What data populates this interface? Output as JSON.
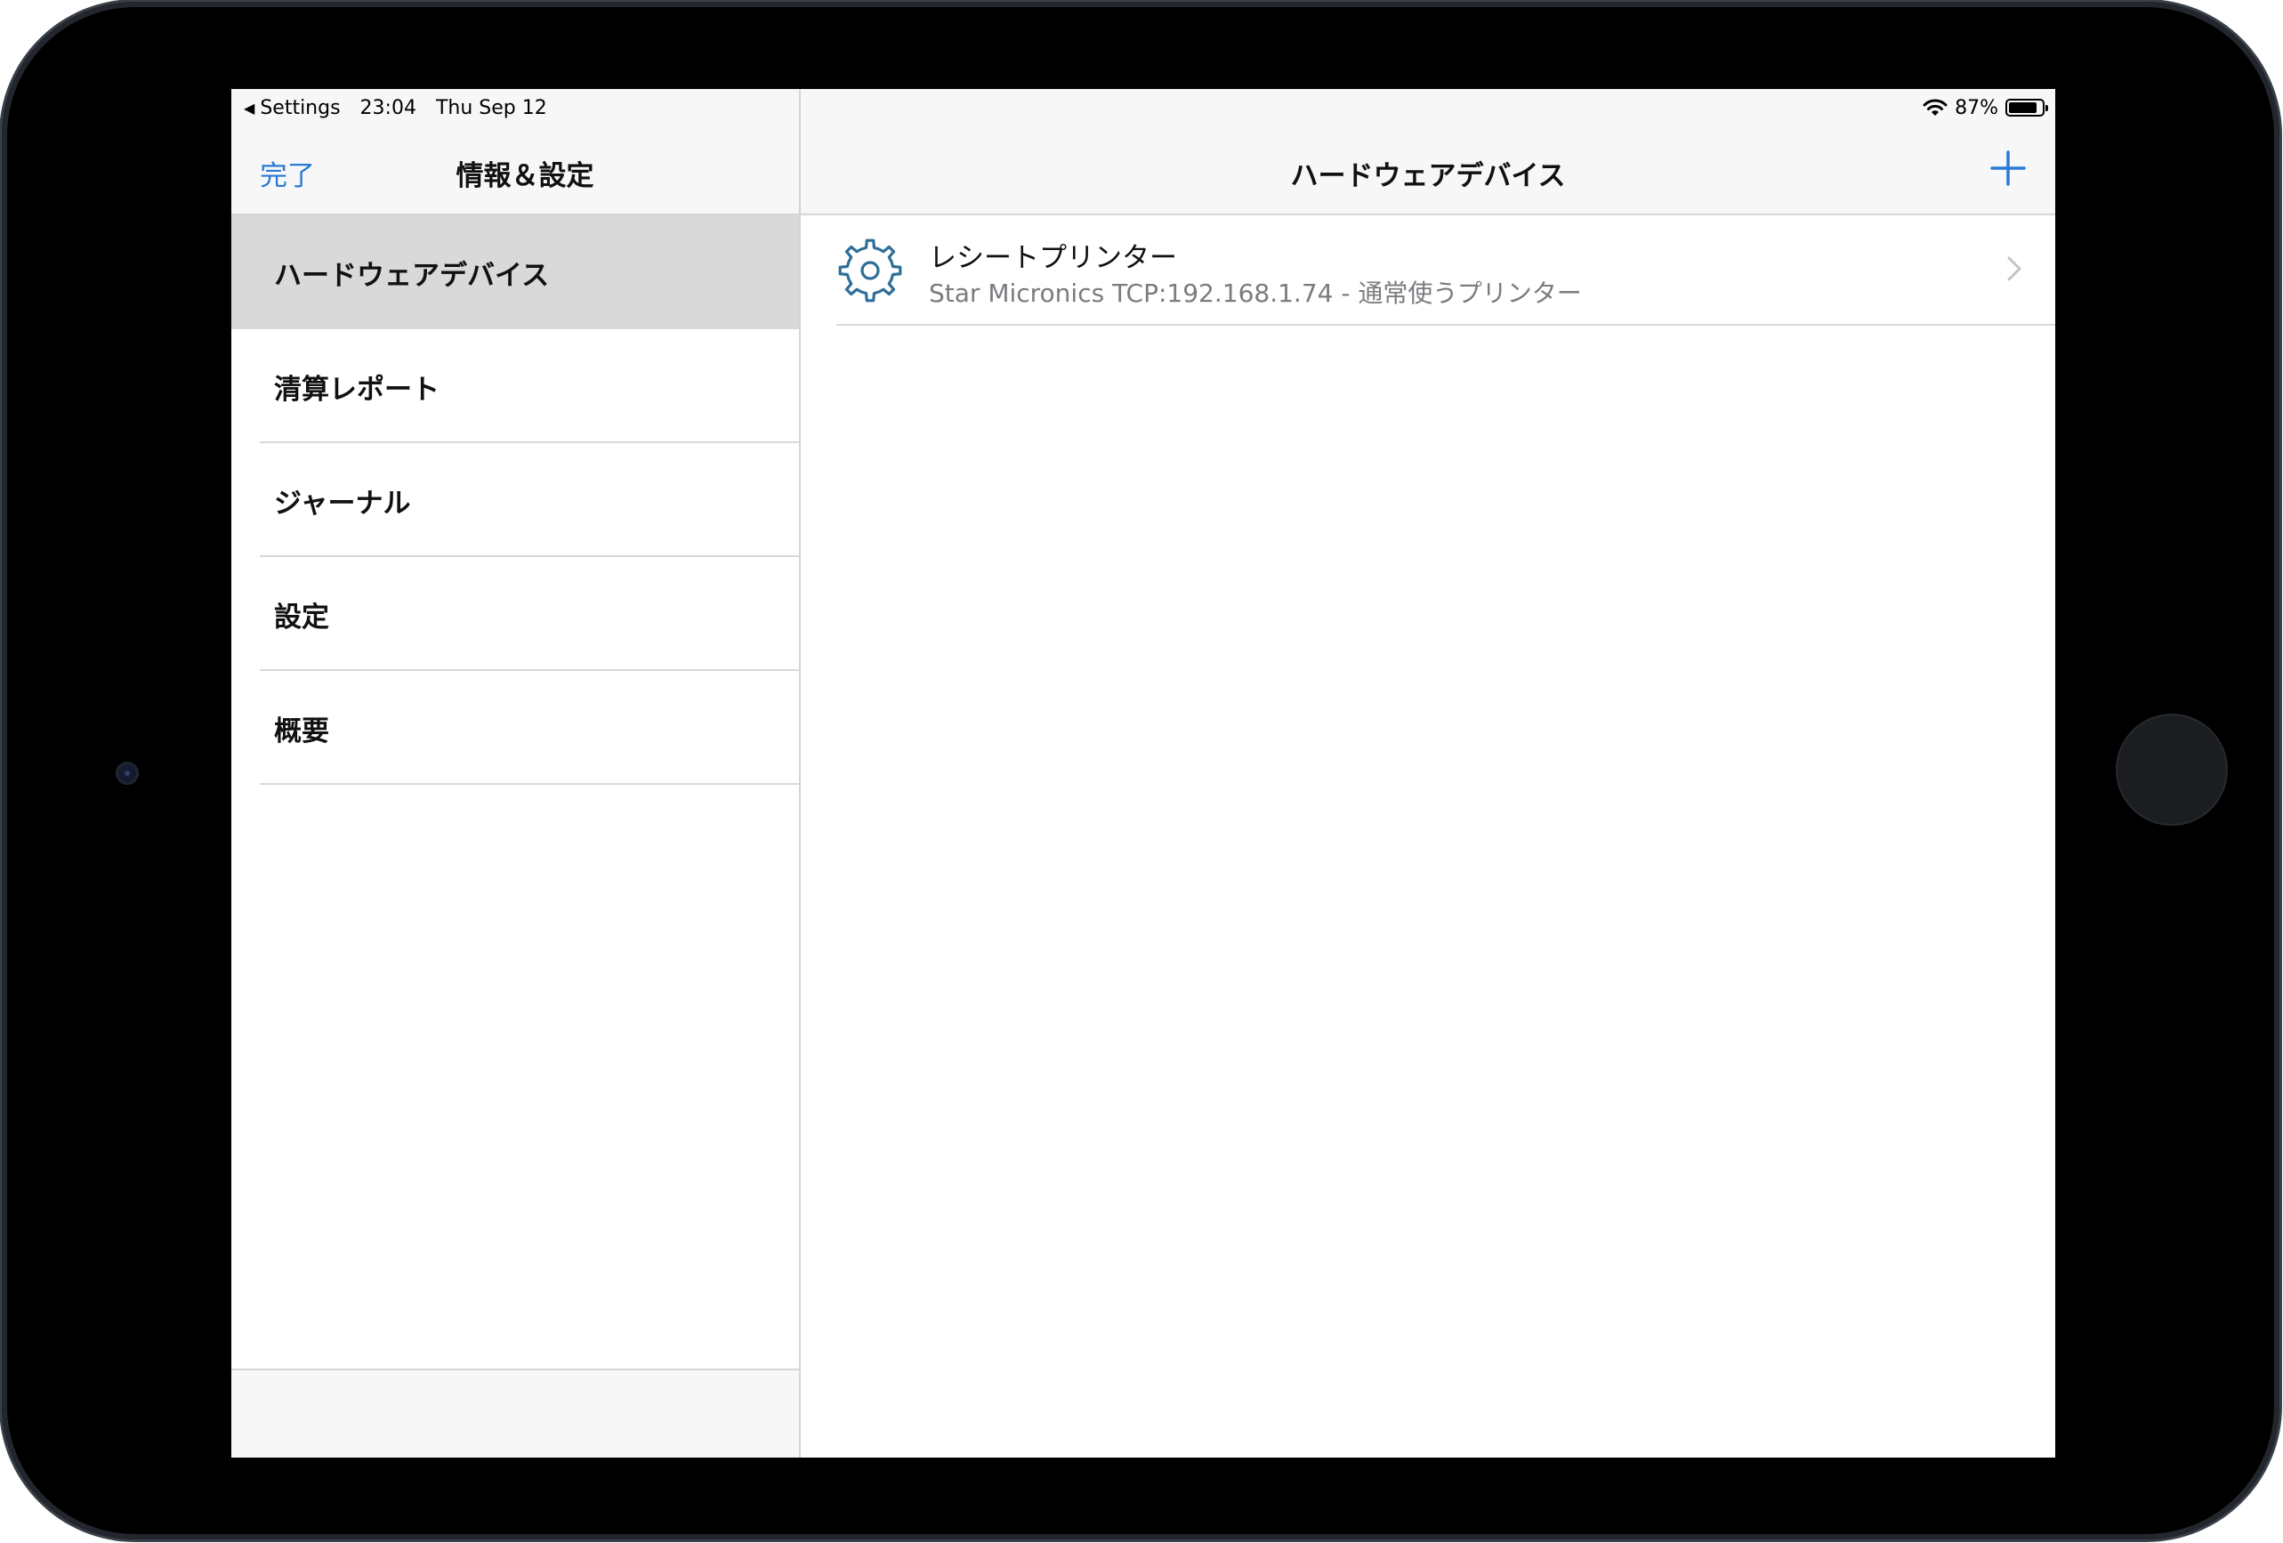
{
  "status_bar": {
    "back_label": "Settings",
    "time": "23:04",
    "date": "Thu Sep 12",
    "battery": "87%",
    "battery_level": 0.87
  },
  "master": {
    "done_label": "完了",
    "title": "情報＆設定",
    "items": [
      {
        "label": "ハードウェアデバイス",
        "selected": true
      },
      {
        "label": "清算レポート",
        "selected": false
      },
      {
        "label": "ジャーナル",
        "selected": false
      },
      {
        "label": "設定",
        "selected": false
      },
      {
        "label": "概要",
        "selected": false
      }
    ]
  },
  "detail": {
    "title": "ハードウェアデバイス",
    "add_icon": "plus-icon",
    "devices": [
      {
        "icon": "gear-icon",
        "title": "レシートプリンター",
        "subtitle": "Star Micronics TCP:192.168.1.74 - 通常使うプリンター"
      }
    ]
  },
  "colors": {
    "accent": "#2a7ad6",
    "selected_row": "#d9d9d9",
    "bar_background": "#f7f7f7",
    "gear_icon": "#2f6e98",
    "device_frame": "#000000"
  }
}
